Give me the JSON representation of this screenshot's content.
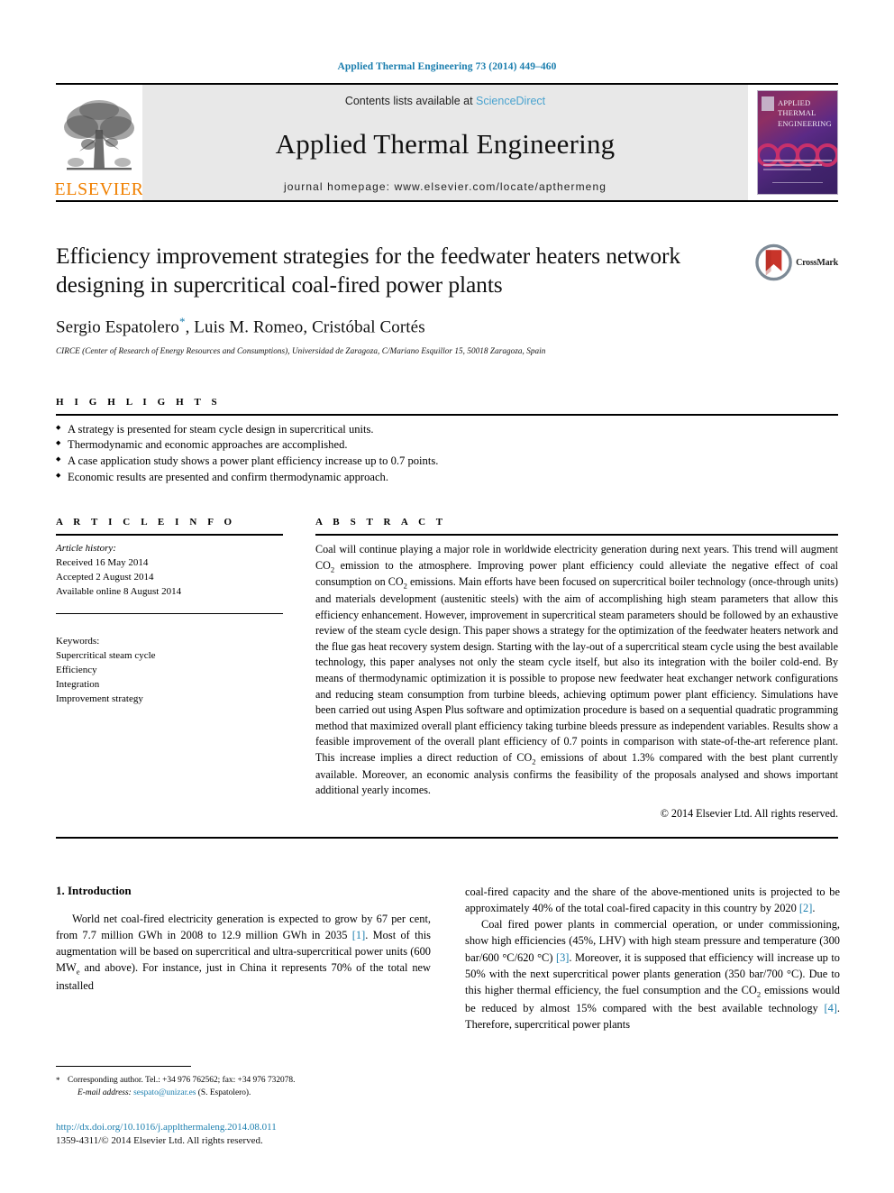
{
  "running_head": "Applied Thermal Engineering 73 (2014) 449–460",
  "masthead": {
    "publisher_name": "ELSEVIER",
    "contents_prefix": "Contents lists available at ",
    "contents_link": "ScienceDirect",
    "journal_name": "Applied Thermal Engineering",
    "homepage_line": "journal homepage: www.elsevier.com/locate/apthermeng",
    "cover_title_line1": "APPLIED",
    "cover_title_line2": "THERMAL",
    "cover_title_line3": "ENGINEERING"
  },
  "article": {
    "title": "Efficiency improvement strategies for the feedwater heaters network designing in supercritical coal-fired power plants",
    "authors": "Sergio Espatolero",
    "authors_rest": ", Luis M. Romeo, Cristóbal Cortés",
    "corresponding_marker": "*",
    "affiliation": "CIRCE (Center of Research of Energy Resources and Consumptions), Universidad de Zaragoza, C/Mariano Esquillor 15, 50018 Zaragoza, Spain",
    "crossmark_label": "CrossMark"
  },
  "highlights": {
    "heading": "H I G H L I G H T S",
    "items": [
      "A strategy is presented for steam cycle design in supercritical units.",
      "Thermodynamic and economic approaches are accomplished.",
      "A case application study shows a power plant efficiency increase up to 0.7 points.",
      "Economic results are presented and confirm thermodynamic approach."
    ]
  },
  "article_info": {
    "heading": "A R T I C L E  I N F O",
    "history_label": "Article history:",
    "history": [
      "Received 16 May 2014",
      "Accepted 2 August 2014",
      "Available online 8 August 2014"
    ],
    "keywords_label": "Keywords:",
    "keywords": [
      "Supercritical steam cycle",
      "Efficiency",
      "Integration",
      "Improvement strategy"
    ]
  },
  "abstract": {
    "heading": "A B S T R A C T",
    "p1": "Coal will continue playing a major role in worldwide electricity generation during next years. This trend will augment CO",
    "p1b": " emission to the atmosphere. Improving power plant efficiency could alleviate the negative effect of coal consumption on CO",
    "p1c": " emissions. Main efforts have been focused on supercritical boiler technology (once-through units) and materials development (austenitic steels) with the aim of accomplishing high steam parameters that allow this efficiency enhancement. However, improvement in supercritical steam parameters should be followed by an exhaustive review of the steam cycle design. This paper shows a strategy for the optimization of the feedwater heaters network and the flue gas heat recovery system design. Starting with the lay-out of a supercritical steam cycle using the best available technology, this paper analyses not only the steam cycle itself, but also its integration with the boiler cold-end. By means of thermodynamic optimization it is possible to propose new feedwater heat exchanger network configurations and reducing steam consumption from turbine bleeds, achieving optimum power plant efficiency. Simulations have been carried out using Aspen Plus software and optimization procedure is based on a sequential quadratic programming method that maximized overall plant efficiency taking turbine bleeds pressure as independent variables. Results show a feasible improvement of the overall plant efficiency of 0.7 points in comparison with state-of-the-art reference plant. This increase implies a direct reduction of CO",
    "p1d": " emissions of about 1.3% compared with the best plant currently available. Moreover, an economic analysis confirms the feasibility of the proposals analysed and shows important additional yearly incomes.",
    "copyright": "© 2014 Elsevier Ltd. All rights reserved."
  },
  "body": {
    "section_heading": "1. Introduction",
    "left_p1_a": "World net coal-fired electricity generation is expected to grow by 67 per cent, from 7.7 million GWh in 2008 to 12.9 million GWh in 2035 ",
    "left_p1_ref": "[1]",
    "left_p1_b": ". Most of this augmentation will be based on supercritical and ultra-supercritical power units (600 MW",
    "left_p1_sub": "e",
    "left_p1_c": " and above). For instance, just in China it represents 70% of the total new installed",
    "right_p1_a": "coal-fired capacity and the share of the above-mentioned units is projected to be approximately 40% of the total coal-fired capacity in this country by 2020 ",
    "right_p1_ref": "[2]",
    "right_p1_b": ".",
    "right_p2_a": "Coal fired power plants in commercial operation, or under commissioning, show high efficiencies (45%, LHV) with high steam pressure and temperature (300 bar/600 °C/620 °C) ",
    "right_p2_ref1": "[3]",
    "right_p2_b": ". Moreover, it is supposed that efficiency will increase up to 50% with the next supercritical power plants generation (350 bar/700 °C). Due to this higher thermal efficiency, the fuel consumption and the CO",
    "right_p2_sub": "2",
    "right_p2_c": " emissions would be reduced by almost 15% compared with the best available technology ",
    "right_p2_ref2": "[4]",
    "right_p2_d": ". Therefore, supercritical power plants"
  },
  "footnotes": {
    "corresponding": "Corresponding author. Tel.: +34 976 762562; fax: +34 976 732078.",
    "email_label": "E-mail address:",
    "email": "sespato@unizar.es",
    "email_suffix": "(S. Espatolero).",
    "doi": "http://dx.doi.org/10.1016/j.applthermaleng.2014.08.011",
    "issn": "1359-4311/© 2014 Elsevier Ltd. All rights reserved."
  },
  "colors": {
    "link_blue": "#1b7eae",
    "sciencedirect_blue": "#4aa3cf",
    "elsevier_orange": "#f08000"
  }
}
